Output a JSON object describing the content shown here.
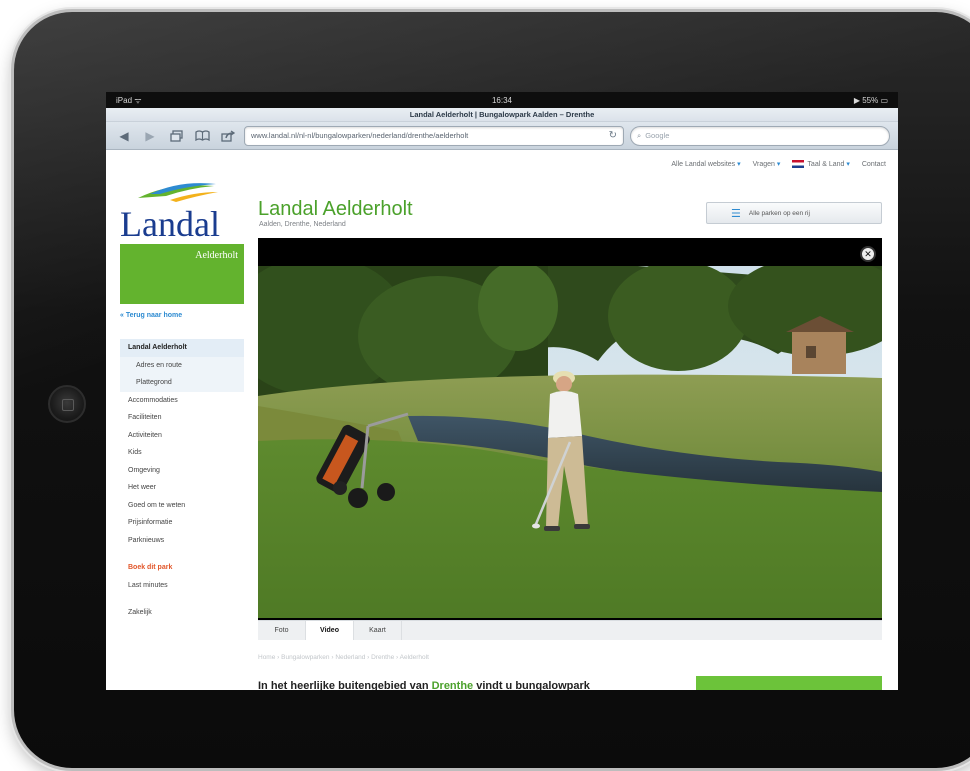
{
  "status_bar": {
    "carrier": "iPad ᯤ",
    "time": "16:34",
    "battery": "▶ 55% ▭"
  },
  "browser": {
    "title": "Landal Aelderholt | Bungalowpark Aalden – Drenthe",
    "url": "www.landal.nl/nl-nl/bungalowparken/nederland/drenthe/aelderholt",
    "search_placeholder": "Google"
  },
  "topnav": {
    "sites": "Alle Landal websites",
    "questions": "Vragen",
    "language": "Taal & Land",
    "contact": "Contact"
  },
  "logo": {
    "brand": "Landal",
    "park": "Aelderholt"
  },
  "park": {
    "title": "Landal Aelderholt",
    "subtitle": "Aalden, Drenthe, Nederland",
    "all_parks_button": "Alle parken op een rij"
  },
  "sidenav": {
    "back": "« Terug naar home",
    "items": [
      "Landal Aelderholt",
      "Adres en route",
      "Plattegrond",
      "Accommodaties",
      "Faciliteiten",
      "Activiteiten",
      "Kids",
      "Omgeving",
      "Het weer",
      "Goed om te weten",
      "Prijsinformatie",
      "Parknieuws"
    ],
    "book": "Boek dit park",
    "last_minutes": "Last minutes",
    "business": "Zakelijk"
  },
  "media_tabs": [
    "Foto",
    "Video",
    "Kaart"
  ],
  "breadcrumb": "Home › Bungalowparken › Nederland › Drenthe › Aelderholt",
  "headline": {
    "prefix": "In het heerlijke buitengebied van ",
    "place": "Drenthe",
    "suffix": " vindt u bungalowpark"
  },
  "colors": {
    "brand_green": "#63b32e",
    "brand_blue": "#1a3c8f",
    "link_blue": "#2e8bd1",
    "book_orange": "#e2572b"
  }
}
